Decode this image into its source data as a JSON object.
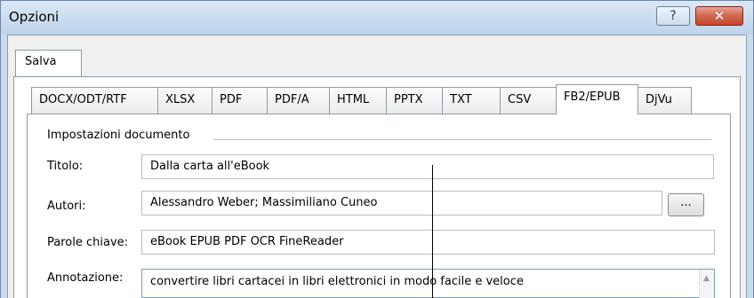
{
  "window": {
    "title": "Opzioni",
    "help_label": "?",
    "close_label": "✕"
  },
  "outer_tab": {
    "label": "Salva"
  },
  "tabs": [
    {
      "label": "DOCX/ODT/RTF"
    },
    {
      "label": "XLSX"
    },
    {
      "label": "PDF"
    },
    {
      "label": "PDF/A"
    },
    {
      "label": "HTML"
    },
    {
      "label": "PPTX"
    },
    {
      "label": "TXT"
    },
    {
      "label": "CSV"
    },
    {
      "label": "FB2/EPUB"
    },
    {
      "label": "DjVu"
    }
  ],
  "active_tab": "FB2/EPUB",
  "group": {
    "label": "Impostazioni documento"
  },
  "fields": {
    "title": {
      "label": "Titolo:",
      "value": "Dalla carta all'eBook"
    },
    "authors": {
      "label": "Autori:",
      "value": "Alessandro Weber; Massimiliano Cuneo",
      "browse_label": "..."
    },
    "keywords": {
      "label": "Parole chiave:",
      "value": "eBook EPUB PDF OCR FineReader"
    },
    "annotation": {
      "label": "Annotazione:",
      "value": "convertire libri cartacei in libri elettronici in modo facile e veloce"
    }
  },
  "icons": {
    "scroll_up": "scroll-up-arrow-icon"
  },
  "colors": {
    "title_bar": "#c8dbee",
    "close_button": "#c4472c",
    "field_border": "#b6bcc6"
  }
}
